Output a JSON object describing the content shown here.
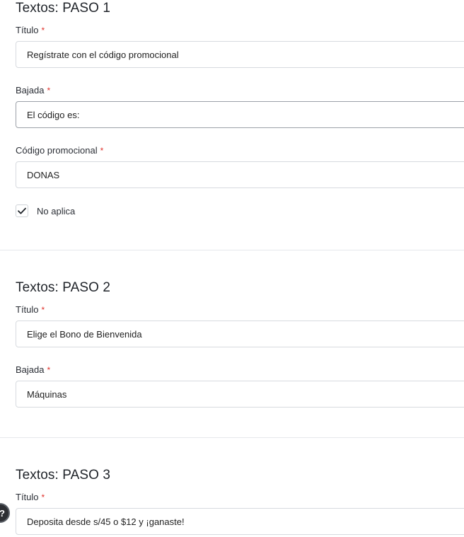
{
  "paso1": {
    "title": "Textos: PASO 1",
    "titulo_label": "Título",
    "titulo_value": "Regístrate con el código promocional",
    "bajada_label": "Bajada",
    "bajada_value": "El código es:",
    "codigo_label": "Código promocional",
    "codigo_value": "DONAS",
    "checkbox_label": "No aplica",
    "checkbox_checked": true
  },
  "paso2": {
    "title": "Textos: PASO 2",
    "titulo_label": "Título",
    "titulo_value": "Elige el Bono de Bienvenida",
    "bajada_label": "Bajada",
    "bajada_value": "Máquinas"
  },
  "paso3": {
    "title": "Textos: PASO 3",
    "titulo_label": "Título",
    "titulo_value": "Deposita desde s/45 o $12 y ¡ganaste!"
  },
  "required_marker": "*",
  "help_button": {
    "icon": "help-icon",
    "glyph": "?"
  },
  "colors": {
    "required": "#e0312b",
    "border": "#d7dadf",
    "divider": "#e6e8eb"
  }
}
